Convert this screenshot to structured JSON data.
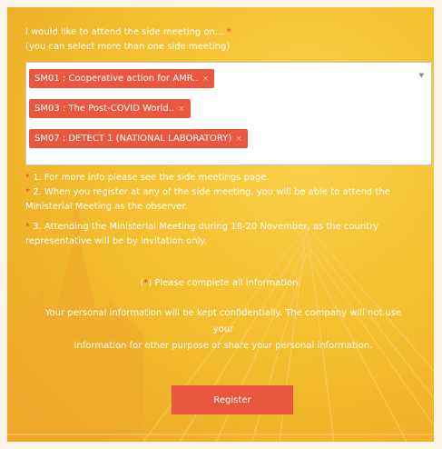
{
  "form": {
    "question": "I would like to attend the side meeting on...",
    "required_mark": "*",
    "hint": "(you can select more than one side meeting)",
    "selected_options": [
      {
        "label": "SM01 : Cooperative action for AMR..",
        "remove": "×"
      },
      {
        "label": "SM03 : The Post-COVID World..",
        "remove": "×"
      },
      {
        "label": "SM07 : DETECT 1 (NATIONAL LABORATORY)",
        "remove": "×"
      }
    ],
    "dropdown_icon": "chevron-down-icon",
    "notes": [
      "1. For more info please see the side meetings page.",
      "2. When you register at any of the side meeting, you will be able to attend the Ministerial Meeting as the observer.",
      "3. Attending the Ministerial Meeting during 18-20 November, as the country representative will be by invitation only."
    ],
    "complete_prefix": "(",
    "complete_star": "*",
    "complete_suffix": ") Please complete all information.",
    "privacy_line1": "Your personal information will be kept confidentially. The company will not use",
    "privacy_line2": "your",
    "privacy_line3": "information for other purpose or share your personal information.",
    "register_label": "Register"
  },
  "colors": {
    "accent": "#e8573e",
    "background": "#f4c02f",
    "text": "#ffffff"
  }
}
